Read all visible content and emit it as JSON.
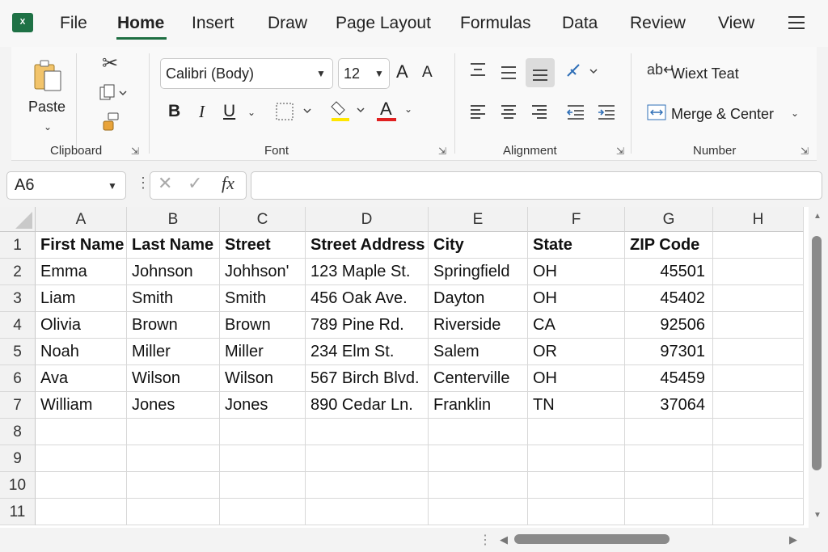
{
  "menu": {
    "items": [
      "File",
      "Home",
      "Insert",
      "Draw",
      "Page Layout",
      "Formulas",
      "Data",
      "Review",
      "View"
    ],
    "active": "Home"
  },
  "ribbon": {
    "clipboard": {
      "paste_label": "Paste",
      "group_label": "Clipboard"
    },
    "font": {
      "font_name": "Calibri (Body)",
      "font_size": "12",
      "grow_label": "A",
      "shrink_label": "A",
      "bold": "B",
      "italic": "I",
      "underline": "U",
      "font_color_label": "A",
      "group_label": "Font",
      "highlight_color": "#ffe600",
      "font_color": "#e02020"
    },
    "alignment": {
      "group_label": "Alignment"
    },
    "number": {
      "wrap_text_label": "Wiext Teat",
      "merge_center_label": "Merge & Center",
      "group_label": "Number"
    }
  },
  "formula_bar": {
    "name_box": "A6",
    "fx_label": "fx",
    "formula": ""
  },
  "sheet": {
    "columns": [
      "A",
      "B",
      "C",
      "D",
      "E",
      "F",
      "G",
      "H"
    ],
    "rows": [
      "1",
      "2",
      "3",
      "4",
      "5",
      "6",
      "7",
      "8",
      "9",
      "10",
      "11"
    ],
    "header": [
      "First Name",
      "Last Name",
      "Street",
      "Street Address",
      "City",
      "State",
      "ZIP Code"
    ],
    "data": [
      [
        "Emma",
        "Johnson",
        "Johhson'",
        "123 Maple St.",
        "Springfield",
        "OH",
        "45501"
      ],
      [
        "Liam",
        "Smith",
        "Smith",
        "456 Oak Ave.",
        "Dayton",
        "OH",
        "45402"
      ],
      [
        "Olivia",
        "Brown",
        "Brown",
        "789 Pine Rd.",
        "Riverside",
        "CA",
        "92506"
      ],
      [
        "Noah",
        "Miller",
        "Miller",
        "234 Elm St.",
        "Salem",
        "OR",
        "97301"
      ],
      [
        "Ava",
        "Wilson",
        "Wilson",
        "567 Birch Blvd.",
        "Centerville",
        "OH",
        "45459"
      ],
      [
        "William",
        "Jones",
        "Jones",
        "890 Cedar Ln.",
        "Franklin",
        "TN",
        "37064"
      ]
    ]
  }
}
